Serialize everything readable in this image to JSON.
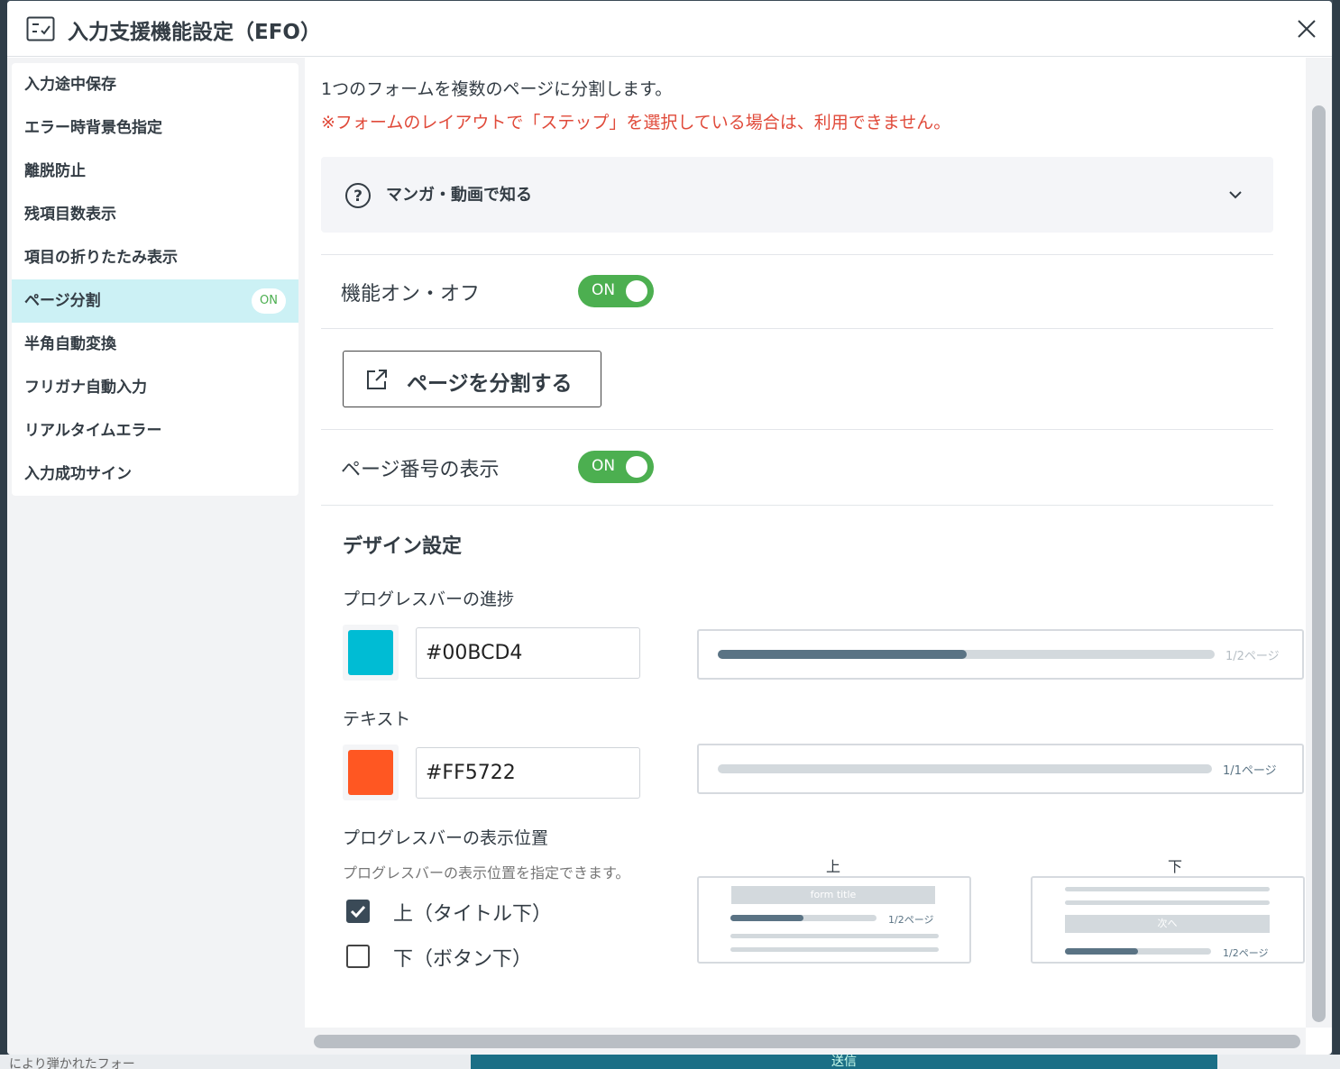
{
  "modal": {
    "title": "入力支援機能設定（EFO）"
  },
  "sidebar": {
    "items": [
      {
        "label": "入力途中保存"
      },
      {
        "label": "エラー時背景色指定"
      },
      {
        "label": "離脱防止"
      },
      {
        "label": "残項目数表示"
      },
      {
        "label": "項目の折りたたみ表示"
      },
      {
        "label": "ページ分割",
        "badge": "ON",
        "active": true
      },
      {
        "label": "半角自動変換"
      },
      {
        "label": "フリガナ自動入力"
      },
      {
        "label": "リアルタイムエラー"
      },
      {
        "label": "入力成功サイン"
      }
    ]
  },
  "main": {
    "description": "1つのフォームを複数のページに分割します。",
    "warning": "※フォームのレイアウトで「ステップ」を選択している場合は、利用できません。",
    "manga_label": "マンガ・動画で知る",
    "feature_toggle": {
      "label": "機能オン・オフ",
      "state": "ON"
    },
    "split_button_label": "ページを分割する",
    "page_number_toggle": {
      "label": "ページ番号の表示",
      "state": "ON"
    },
    "design": {
      "title": "デザイン設定",
      "progress_label": "プログレスバーの進捗",
      "progress_color": "#00BCD4",
      "text_label": "テキスト",
      "text_color": "#FF5722",
      "preview_progress": {
        "text": "1/2ページ",
        "fill_fraction": 0.5
      },
      "preview_text": {
        "text": "1/1ページ",
        "fill_fraction": 0
      }
    },
    "position": {
      "title": "プログレスバーの表示位置",
      "description": "プログレスバーの表示位置を指定できます。",
      "options": [
        {
          "label": "上（タイトル下）",
          "checked": true
        },
        {
          "label": "下（ボタン下）",
          "checked": false
        }
      ],
      "top_preview": {
        "heading": "上",
        "form_title": "form title",
        "page_text": "1/2ページ"
      },
      "bottom_preview": {
        "heading": "下",
        "next_label": "次へ",
        "page_text": "1/2ページ"
      }
    }
  },
  "background": {
    "bottom_text": "により弾かれたフォー",
    "bottom_button": "送信"
  },
  "colors": {
    "toggle_on": "#4caf50",
    "active_item_bg": "#ccf1f5",
    "warning": "#e04a3a",
    "bar_fill": "#5a7384"
  }
}
